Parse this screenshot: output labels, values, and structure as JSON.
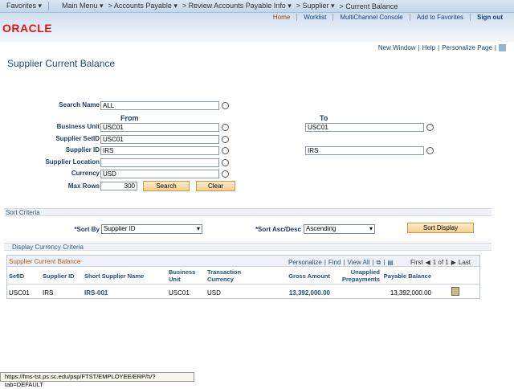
{
  "nav": {
    "favorites": "Favorites ▾",
    "main_menu": "Main Menu ▾",
    "crumbs": [
      "> Accounts Payable ▾",
      "> Review Accounts Payable Info ▾",
      "> Supplier ▾",
      "> Current Balance"
    ]
  },
  "header": {
    "links": [
      "Home",
      "Worklist",
      "MultiChannel Console",
      "Add to Favorites",
      "Sign out"
    ],
    "logo": "ORACLE"
  },
  "subheader": {
    "new_window": "New Window",
    "help": "Help",
    "personalize": "Personalize Page"
  },
  "page_title": "Supplier Current Balance",
  "form": {
    "from": "From",
    "to": "To",
    "search_name": {
      "label": "Search Name",
      "value": "ALL"
    },
    "business_unit": {
      "label": "Business Unit",
      "from": "USC01",
      "to": "USC01"
    },
    "supplier_setid": {
      "label": "Supplier SetID",
      "value": "USC01"
    },
    "supplier_id": {
      "label": "Supplier ID",
      "from": "IRS",
      "to": "IRS"
    },
    "supplier_location": {
      "label": "Supplier Location",
      "value": ""
    },
    "currency": {
      "label": "Currency",
      "value": "USD"
    },
    "max_rows": {
      "label": "Max Rows",
      "value": "300"
    },
    "search": "Search",
    "clear": "Clear"
  },
  "sort": {
    "section": "Sort Criteria",
    "sort_by_label": "*Sort By",
    "sort_by": "Supplier ID",
    "asc_label": "*Sort Asc/Desc",
    "asc": "Ascending",
    "sort_display": "Sort Display"
  },
  "display_currency": "Display Currency Criteria",
  "grid": {
    "title": "Supplier Current Balance",
    "personalize": "Personalize",
    "find": "Find",
    "view_all": "View All",
    "first": "First",
    "range": "1 of 1",
    "last": "Last",
    "columns": [
      "SetID",
      "Supplier ID",
      "Short Supplier Name",
      "Business Unit",
      "Transaction Currency",
      "Gross Amount",
      "Unapplied Prepayments",
      "Payable Balance"
    ],
    "rows": [
      [
        "USC01",
        "IRS",
        "IRS-001",
        "USC01",
        "USD",
        "13,392,000.00",
        "",
        "13,392,000.00"
      ]
    ]
  },
  "status_url": "https://fms-tst.ps.sc.edu/psp/FTST/EMPLOYEE/ERP/h/?tab=DEFAULT"
}
